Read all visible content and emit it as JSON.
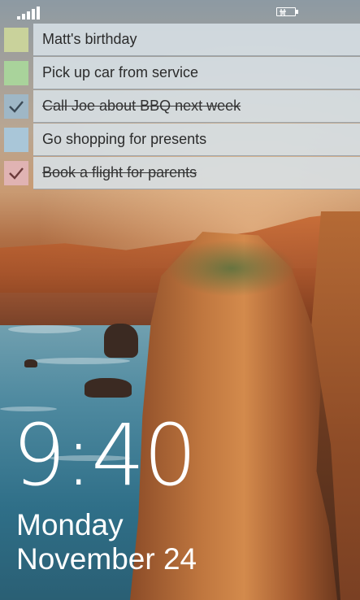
{
  "status_bar": {
    "signal_icon": "signal-strength-icon",
    "battery_icon": "battery-charging-icon"
  },
  "tasks": [
    {
      "label": "Matt's birthday",
      "done": false,
      "color": "#c9d29b"
    },
    {
      "label": "Pick up car from service",
      "done": false,
      "color": "#a9d39b"
    },
    {
      "label": "Call Joe about BBQ next week",
      "done": true,
      "color": "#9fb7c6"
    },
    {
      "label": "Go shopping for presents",
      "done": false,
      "color": "#a9c6d8"
    },
    {
      "label": "Book a flight for parents",
      "done": true,
      "color": "#e0b3b3"
    }
  ],
  "lock_screen": {
    "time": "9:40",
    "day": "Monday",
    "date": "November 24"
  },
  "background": "coastal-cliffs-sunset-photo"
}
